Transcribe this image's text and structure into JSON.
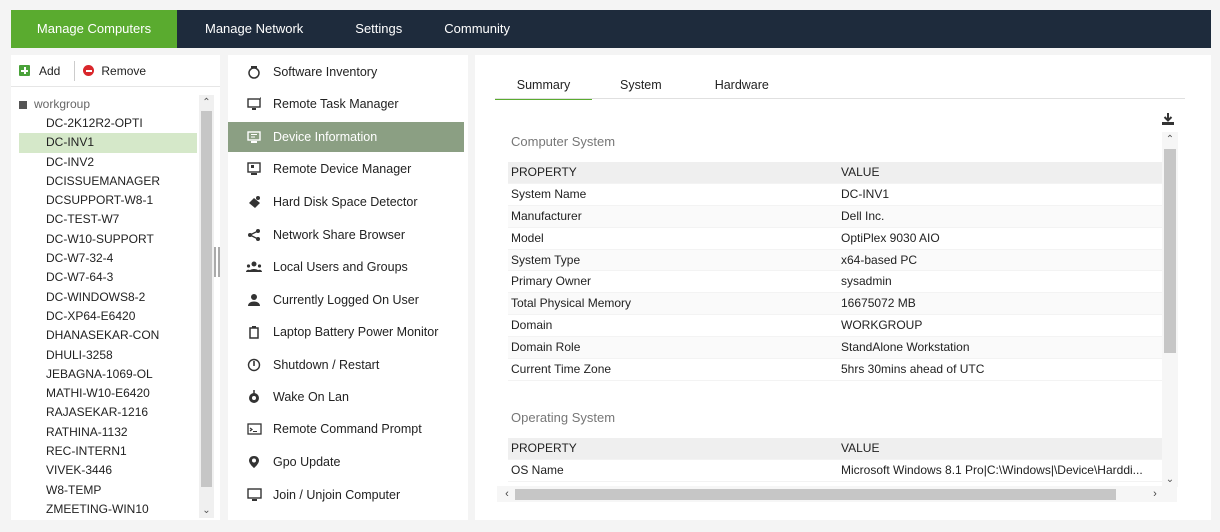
{
  "nav": {
    "tabs": [
      "Manage Computers",
      "Manage Network",
      "Settings",
      "Community"
    ]
  },
  "left": {
    "add_label": "Add",
    "remove_label": "Remove",
    "tree_root": "workgroup",
    "computers": [
      "DC-2K12R2-OPTI",
      "DC-INV1",
      "DC-INV2",
      "DCISSUEMANAGER",
      "DCSUPPORT-W8-1",
      "DC-TEST-W7",
      "DC-W10-SUPPORT",
      "DC-W7-32-4",
      "DC-W7-64-3",
      "DC-WINDOWS8-2",
      "DC-XP64-E6420",
      "DHANASEKAR-CON",
      "DHULI-3258",
      "JEBAGNA-1069-OL",
      "MATHI-W10-E6420",
      "RAJASEKAR-1216",
      "RATHINA-1132",
      "REC-INTERN1",
      "VIVEK-3446",
      "W8-TEMP",
      "ZMEETING-WIN10"
    ],
    "selected": "DC-INV1"
  },
  "menu": {
    "items": [
      {
        "label": "Software Inventory",
        "icon": "software-inventory-icon"
      },
      {
        "label": "Remote Task Manager",
        "icon": "task-manager-icon"
      },
      {
        "label": "Device Information",
        "icon": "device-info-icon"
      },
      {
        "label": "Remote Device Manager",
        "icon": "device-manager-icon"
      },
      {
        "label": "Hard Disk Space Detector",
        "icon": "disk-space-icon"
      },
      {
        "label": "Network Share Browser",
        "icon": "share-icon"
      },
      {
        "label": "Local Users and Groups",
        "icon": "users-group-icon"
      },
      {
        "label": "Currently Logged On User",
        "icon": "user-icon"
      },
      {
        "label": "Laptop Battery Power Monitor",
        "icon": "battery-icon"
      },
      {
        "label": "Shutdown / Restart",
        "icon": "power-icon"
      },
      {
        "label": "Wake On Lan",
        "icon": "wake-on-lan-icon"
      },
      {
        "label": "Remote Command Prompt",
        "icon": "command-prompt-icon"
      },
      {
        "label": "Gpo Update",
        "icon": "location-pin-icon"
      },
      {
        "label": "Join / Unjoin Computer",
        "icon": "join-computer-icon"
      }
    ],
    "active": "Device Information"
  },
  "content": {
    "tabs": [
      "Summary",
      "System",
      "Hardware"
    ],
    "active_tab": "Summary",
    "computer_system": {
      "title": "Computer System",
      "header": {
        "property": "PROPERTY",
        "value": "VALUE"
      },
      "rows": [
        {
          "property": "System Name",
          "value": "DC-INV1"
        },
        {
          "property": "Manufacturer",
          "value": "Dell Inc."
        },
        {
          "property": "Model",
          "value": "OptiPlex 9030 AIO"
        },
        {
          "property": "System Type",
          "value": "x64-based PC"
        },
        {
          "property": "Primary Owner",
          "value": "sysadmin"
        },
        {
          "property": "Total Physical Memory",
          "value": "16675072 MB"
        },
        {
          "property": "Domain",
          "value": "WORKGROUP"
        },
        {
          "property": "Domain Role",
          "value": "StandAlone Workstation"
        },
        {
          "property": "Current Time Zone",
          "value": "5hrs 30mins ahead of UTC"
        }
      ]
    },
    "operating_system": {
      "title": "Operating System",
      "header": {
        "property": "PROPERTY",
        "value": "VALUE"
      },
      "rows": [
        {
          "property": "OS Name",
          "value": "Microsoft Windows 8.1 Pro|C:\\Windows|\\Device\\Harddi..."
        }
      ]
    }
  }
}
